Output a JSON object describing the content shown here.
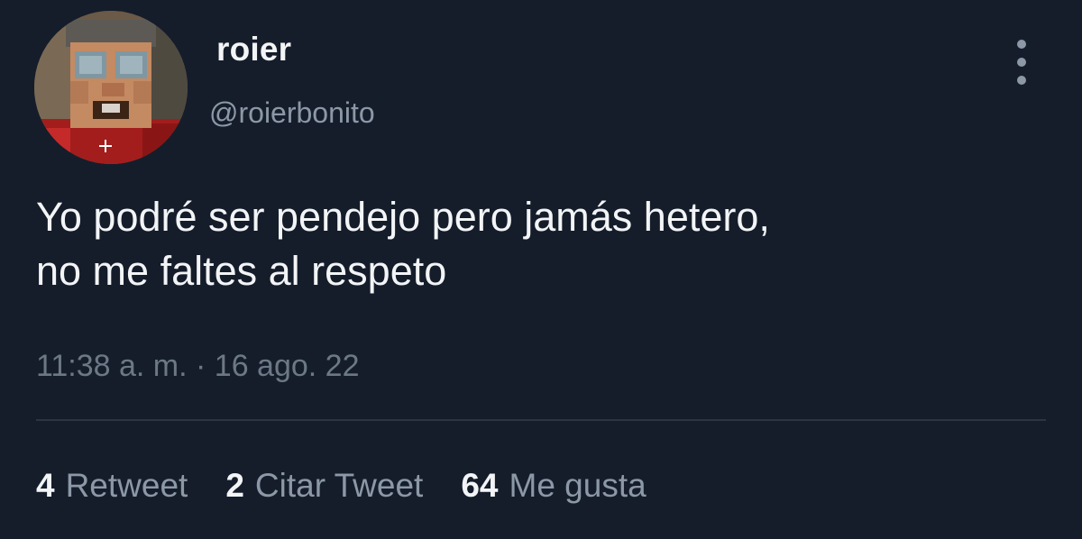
{
  "user": {
    "display_name": "roier",
    "handle": "@roierbonito"
  },
  "more_icon": "more-vertical-icon",
  "tweet": {
    "text": "Yo podré ser pendejo pero jamás hetero,\nno me faltes al respeto",
    "timestamp": "11:38 a. m. · 16 ago. 22"
  },
  "stats": [
    {
      "count": "4",
      "label": "Retweet"
    },
    {
      "count": "2",
      "label": "Citar Tweet"
    },
    {
      "count": "64",
      "label": "Me gusta"
    }
  ],
  "colors": {
    "background": "#151d2b",
    "primary_text": "#f2f4f6",
    "secondary_text": "#8c98a6",
    "timestamp_text": "#6c7885",
    "divider": "#2a3443"
  }
}
